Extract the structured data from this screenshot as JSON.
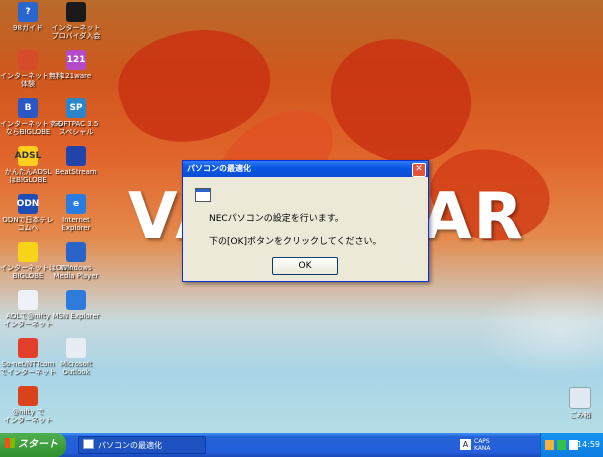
{
  "dialog": {
    "title": "パソコンの最適化",
    "close_glyph": "✕",
    "line1": "NECパソコンの設定を行います。",
    "line2": "下の[OK]ボタンをクリックしてください。",
    "ok_label": "OK"
  },
  "wallpaper": {
    "wordmark_left": "VA",
    "wordmark_right": "AR"
  },
  "desktop_icons": [
    {
      "label": "98ガイド",
      "glyph": "?",
      "color": "#2a66d0"
    },
    {
      "label": "インターネット\nプロバイダ入会",
      "glyph": "",
      "color": "#1a1a1a"
    },
    {
      "label": "インターネット無料\n体験",
      "glyph": "",
      "color": "#d64b2a"
    },
    {
      "label": "121ware",
      "glyph": "121",
      "color": "#b24cc9"
    },
    {
      "label": "インターネットする\nならBIGLOBE",
      "glyph": "B",
      "color": "#2a56c6"
    },
    {
      "label": "SOFTPAC 3.5\nスペシャル",
      "glyph": "SP",
      "color": "#2a86c9"
    },
    {
      "label": "かんたんADSL\nはBIGLOBE",
      "glyph": "ADSL",
      "color": "#ffcf1f"
    },
    {
      "label": "BeatStream",
      "glyph": "",
      "color": "#2244aa"
    },
    {
      "label": "ODNで日本テレ\nコムへ",
      "glyph": "ODN",
      "color": "#1e4db8"
    },
    {
      "label": "Internet\nExplorer",
      "glyph": "e",
      "color": "#2a7de0"
    },
    {
      "label": "インターネットはODN\nBIGLOBE",
      "glyph": "",
      "color": "#f7d417"
    },
    {
      "label": "Windows\nMedia Player",
      "glyph": "",
      "color": "#2a64c8"
    },
    {
      "label": "AOLで@nifty\nインターネット",
      "glyph": "",
      "color": "#eef1f5"
    },
    {
      "label": "MSN Explorer",
      "glyph": "",
      "color": "#2f7bdc"
    },
    {
      "label": "So-net/NTTcom\nでインターネット",
      "glyph": "",
      "color": "#e2402b"
    },
    {
      "label": "Microsoft\nOutlook",
      "glyph": "",
      "color": "#e8ecf3"
    },
    {
      "label": "@nifty で\nインターネット",
      "glyph": "",
      "color": "#d9441c"
    }
  ],
  "recycle_bin": {
    "label": "ごみ箱"
  },
  "taskbar": {
    "start_label": "スタート",
    "window_button": "パソコンの最適化",
    "ime_text": "CAPS KANA",
    "ime_badge": "A",
    "clock": "14:59"
  }
}
